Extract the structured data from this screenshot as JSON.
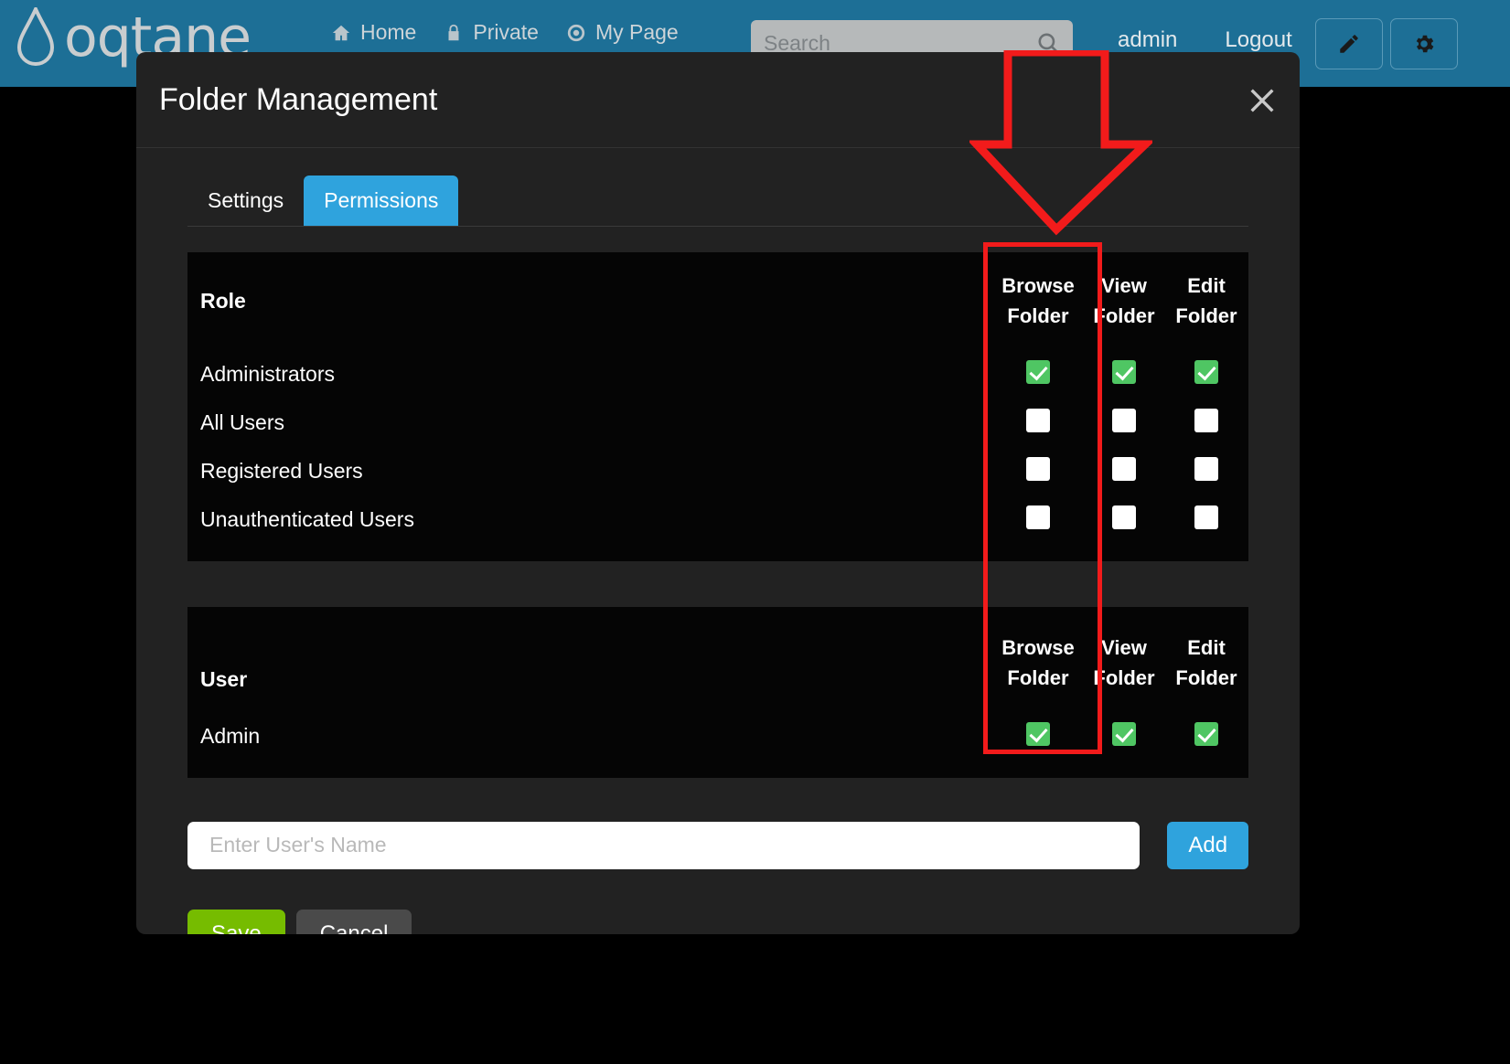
{
  "site_header": {
    "brand": "oqtane",
    "brand_icon": "water-drop-icon",
    "nav": [
      {
        "label": "Home",
        "icon": "home-icon"
      },
      {
        "label": "Private",
        "icon": "lock-icon"
      },
      {
        "label": "My Page",
        "icon": "target-icon"
      }
    ],
    "search": {
      "placeholder": "Search",
      "value": "",
      "icon": "search-icon"
    },
    "user": "admin",
    "logout": "Logout",
    "edit_button_icon": "pencil-icon",
    "settings_button_icon": "gear-icon",
    "accent_color": "#1d6f96"
  },
  "modal": {
    "title": "Folder Management",
    "close_icon": "close-icon",
    "tabs": [
      {
        "label": "Settings",
        "active": false
      },
      {
        "label": "Permissions",
        "active": true
      }
    ],
    "active_tab_color": "#2fa3dd",
    "role_table": {
      "headers": {
        "entity": "Role",
        "permissions": [
          {
            "line1": "Browse",
            "line2": "Folder"
          },
          {
            "line1": "View",
            "line2": "Folder"
          },
          {
            "line1": "Edit",
            "line2": "Folder"
          }
        ]
      },
      "rows": [
        {
          "name": "Administrators",
          "browse": true,
          "view": true,
          "edit": true
        },
        {
          "name": "All Users",
          "browse": false,
          "view": false,
          "edit": false
        },
        {
          "name": "Registered Users",
          "browse": false,
          "view": false,
          "edit": false
        },
        {
          "name": "Unauthenticated Users",
          "browse": false,
          "view": false,
          "edit": false
        }
      ]
    },
    "user_table": {
      "headers": {
        "entity": "User",
        "permissions": [
          {
            "line1": "Browse",
            "line2": "Folder"
          },
          {
            "line1": "View",
            "line2": "Folder"
          },
          {
            "line1": "Edit",
            "line2": "Folder"
          }
        ]
      },
      "rows": [
        {
          "name": "Admin",
          "browse": true,
          "view": true,
          "edit": true
        }
      ]
    },
    "add_user": {
      "placeholder": "Enter User's Name",
      "value": "",
      "button_label": "Add"
    },
    "actions": {
      "save_label": "Save",
      "cancel_label": "Cancel",
      "save_color": "#76bc00",
      "cancel_color": "#4a4a4a"
    },
    "checkbox_checked_color": "#4fc663",
    "checkbox_unchecked_color": "#ffffff"
  },
  "annotation": {
    "color": "#f21b1b",
    "shapes": [
      "down-arrow",
      "highlight-box"
    ],
    "target": "Browse Folder column"
  }
}
